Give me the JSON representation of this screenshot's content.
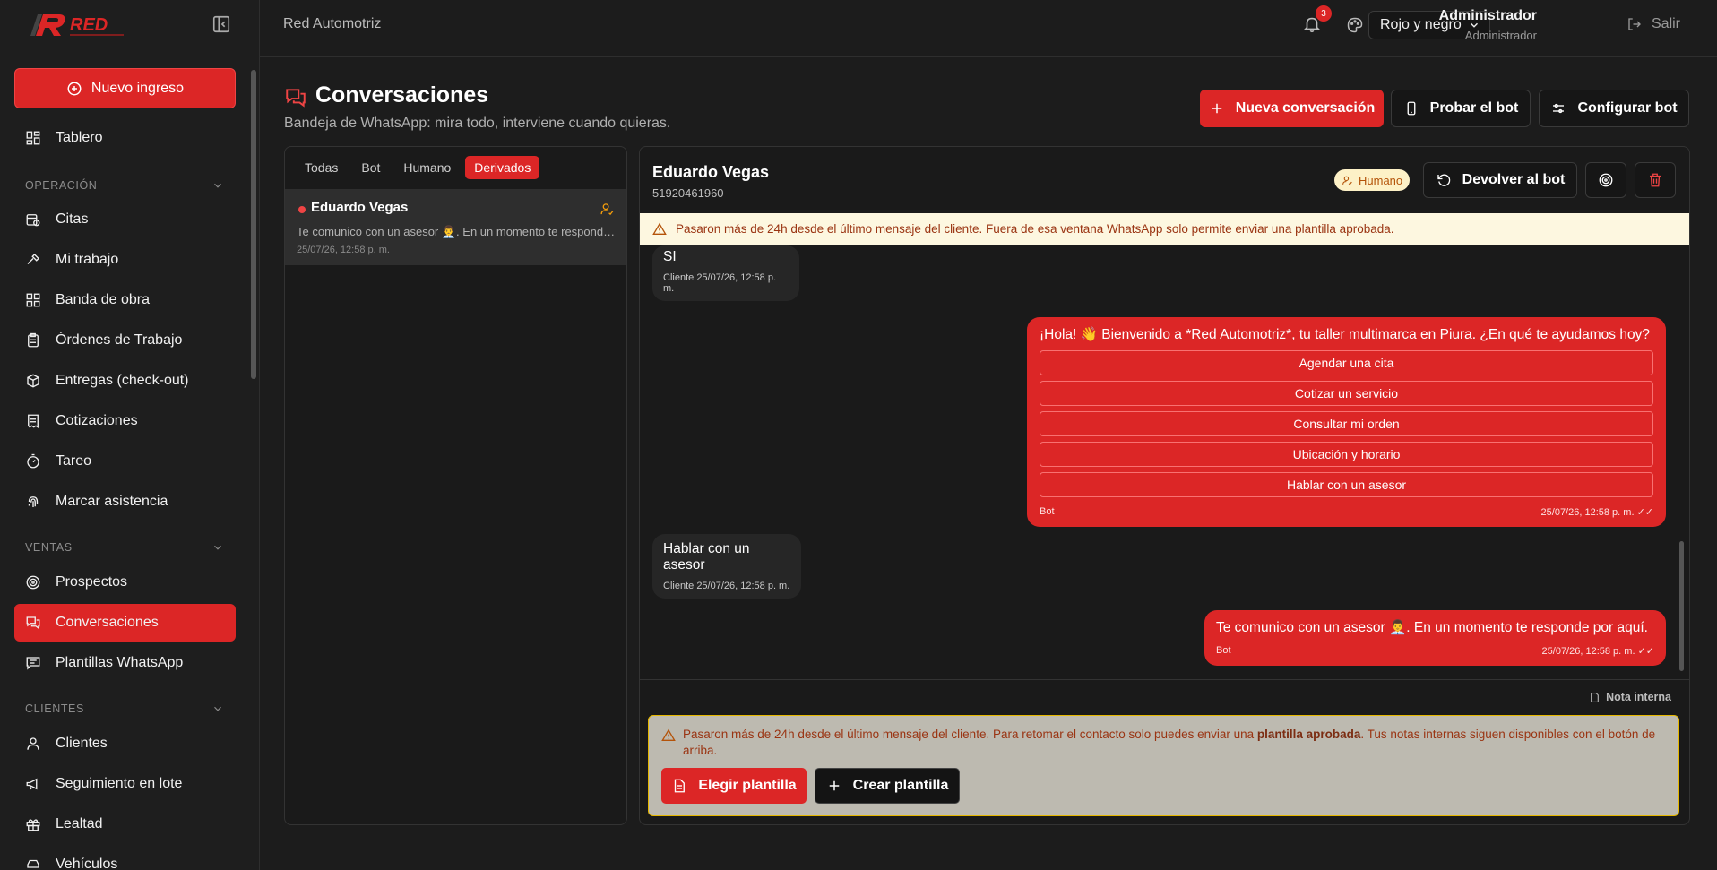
{
  "header": {
    "brand": "Red Automotriz",
    "notification_count": "3",
    "theme": "Rojo y negro",
    "user_name": "Administrador",
    "user_role": "Administrador",
    "logout": "Salir"
  },
  "logo": {
    "text": "RED",
    "icon": "red-automotriz-logo"
  },
  "sidebar": {
    "new_button": "Nuevo ingreso",
    "dashboard": "Tablero",
    "sections": {
      "operacion": "OPERACIÓN",
      "ventas": "VENTAS",
      "clientes": "CLIENTES"
    },
    "items": [
      {
        "label": "Citas",
        "icon": "calendar-clock-icon"
      },
      {
        "label": "Mi trabajo",
        "icon": "hammer-icon"
      },
      {
        "label": "Banda de obra",
        "icon": "grid-icon"
      },
      {
        "label": "Órdenes de Trabajo",
        "icon": "clipboard-icon"
      },
      {
        "label": "Entregas (check-out)",
        "icon": "package-icon"
      },
      {
        "label": "Cotizaciones",
        "icon": "receipt-icon"
      },
      {
        "label": "Tareo",
        "icon": "timer-icon"
      },
      {
        "label": "Marcar asistencia",
        "icon": "fingerprint-icon"
      },
      {
        "label": "Prospectos",
        "icon": "target-icon"
      },
      {
        "label": "Conversaciones",
        "icon": "chat-icon"
      },
      {
        "label": "Plantillas WhatsApp",
        "icon": "message-template-icon"
      },
      {
        "label": "Clientes",
        "icon": "user-icon"
      },
      {
        "label": "Seguimiento en lote",
        "icon": "megaphone-icon"
      },
      {
        "label": "Lealtad",
        "icon": "gift-icon"
      },
      {
        "label": "Vehículos",
        "icon": "car-icon"
      }
    ],
    "active": "Conversaciones"
  },
  "page": {
    "title": "Conversaciones",
    "subtitle": "Bandeja de WhatsApp: mira todo, interviene cuando quieras.",
    "buttons": {
      "new_conversation": "Nueva conversación",
      "test_bot": "Probar el bot",
      "configure_bot": "Configurar bot"
    }
  },
  "list": {
    "tabs": [
      "Todas",
      "Bot",
      "Humano",
      "Derivados"
    ],
    "active_tab": "Derivados",
    "conversations": [
      {
        "name": "Eduardo Vegas",
        "preview": "Te comunico con un asesor 👨‍💼. En un momento te responde por aquí.",
        "time": "25/07/26, 12:58 p. m."
      }
    ]
  },
  "chat": {
    "name": "Eduardo Vegas",
    "phone": "51920461960",
    "mode_badge": "Humano",
    "return_bot": "Devolver al bot",
    "warning": "Pasaron más de 24h desde el último mensaje del cliente. Fuera de esa ventana WhatsApp solo permite enviar una plantilla aprobada.",
    "messages": {
      "m1": {
        "text": "SI",
        "sender": "Cliente",
        "time": "25/07/26, 12:58 p. m."
      },
      "m2": {
        "text": "¡Hola! 👋 Bienvenido a *Red Automotriz*, tu taller multimarca en Piura. ¿En qué te ayudamos hoy?",
        "sender": "Bot",
        "time": "25/07/26, 12:58 p. m.",
        "options": [
          "Agendar una cita",
          "Cotizar un servicio",
          "Consultar mi orden",
          "Ubicación y horario",
          "Hablar con un asesor"
        ]
      },
      "m3": {
        "text": "Hablar con un asesor",
        "sender": "Cliente",
        "time": "25/07/26, 12:58 p. m."
      },
      "m4": {
        "text": "Te comunico con un asesor 👨‍💼. En un momento te responde por aquí.",
        "sender": "Bot",
        "time": "25/07/26, 12:58 p. m."
      }
    },
    "internal_note": "Nota interna",
    "bottom_warning_pre": "Pasaron más de 24h desde el último mensaje del cliente. Para retomar el contacto solo puedes enviar una ",
    "bottom_warning_bold": "plantilla aprobada",
    "bottom_warning_post": ". Tus notas internas siguen disponibles con el botón de arriba.",
    "choose_template": "Elegir plantilla",
    "create_template": "Crear plantilla"
  },
  "colors": {
    "accent": "#dc2626",
    "background": "#1c1c1c",
    "warning_bg": "#fdf7e0"
  }
}
